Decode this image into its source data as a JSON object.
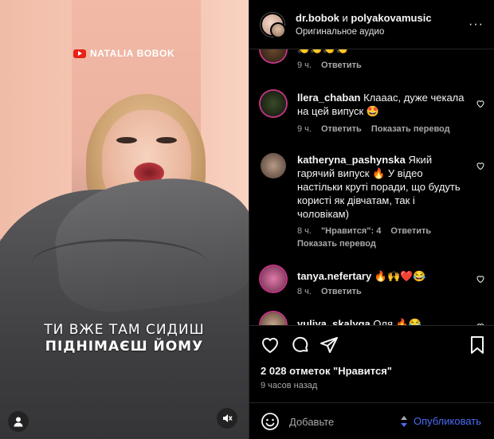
{
  "video": {
    "channel_badge": "NATALIA BOBOK",
    "caption_line1": "ТИ ВЖЕ ТАМ СИДИШ",
    "caption_line2": "ПІДНІМАЄШ ЙОМУ"
  },
  "header": {
    "user1": "dr.bobok",
    "conj": "и",
    "user2": "polyakovamusic",
    "audio": "Оригинальное аудио",
    "more": "···"
  },
  "labels": {
    "reply": "Ответить",
    "translate": "Показать перевод"
  },
  "comments": [
    {
      "user": "",
      "text": "👏👏👏👏",
      "age": "9 ч.",
      "likes": "",
      "translate": false
    },
    {
      "user": "llera_chaban",
      "text": "Клааас, дуже чекала на цей випуск 🤩",
      "age": "9 ч.",
      "likes": "",
      "translate": true
    },
    {
      "user": "katheryna_pashynska",
      "text": "Який гарячий випуск 🔥 У відео настільки круті поради, що будуть користі як дівчатам, так і чоловікам)",
      "age": "8 ч.",
      "likes": "\"Нравится\": 4",
      "translate": true
    },
    {
      "user": "tanya.nefertary",
      "text": "🔥🙌❤️😂",
      "age": "8 ч.",
      "likes": "",
      "translate": false
    },
    {
      "user": "yuliya_skalyga",
      "text": "Оля 🔥😂",
      "age": "",
      "likes": "",
      "translate": false
    }
  ],
  "stats": {
    "likes": "2 028 отметок \"Нравится\"",
    "time": "9 часов назад"
  },
  "composer": {
    "placeholder": "Добавьте",
    "publish": "Опубликовать"
  },
  "colors": {
    "accent": "#4a6cf7",
    "background": "#000000",
    "muted": "#a8a8a8"
  }
}
